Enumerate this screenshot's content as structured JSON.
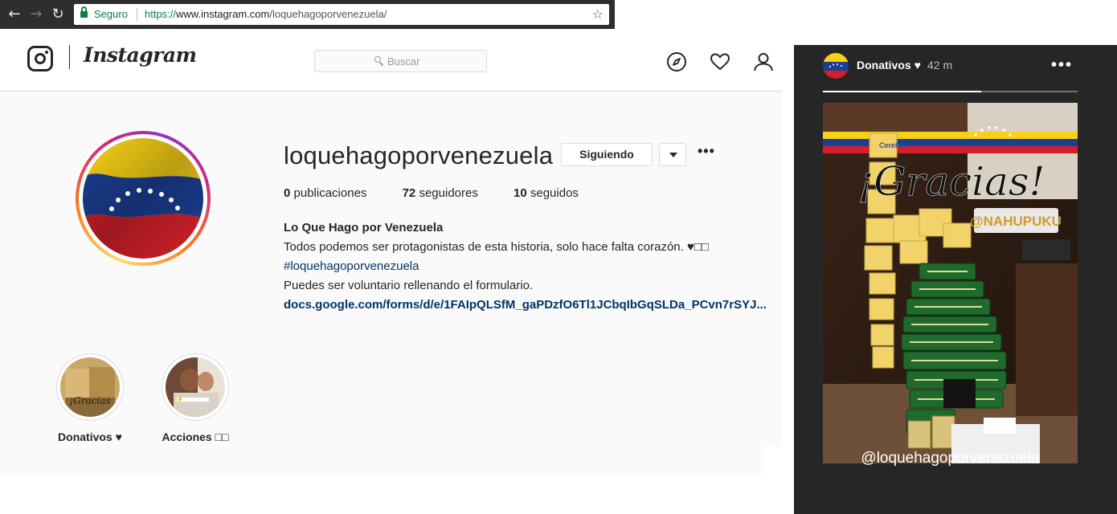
{
  "browser": {
    "secure_label": "Seguro",
    "url_scheme": "https://",
    "url_host": "www.instagram.com",
    "url_path": "/loquehagoporvenezuela/"
  },
  "header": {
    "wordmark": "Instagram",
    "search_placeholder": "Buscar"
  },
  "profile": {
    "username": "loquehagoporvenezuela",
    "follow_button": "Siguiendo",
    "more_label": "•••",
    "stats": {
      "posts": "0",
      "posts_label": "publicaciones",
      "followers": "72",
      "followers_label": "seguidores",
      "following": "10",
      "following_label": "seguidos"
    },
    "bio": {
      "name": "Lo Que Hago por Venezuela",
      "line1": "Todos podemos ser protagonistas de esta historia, solo hace falta corazón. ♥□□",
      "hashtag": "#loquehagoporvenezuela",
      "line3": "Puedes ser voluntario rellenando el formulario.",
      "link": "docs.google.com/forms/d/e/1FAIpQLSfM_gaPDzfO6Tl1JCbqIbGqSLDa_PCvn7rSYJ..."
    },
    "highlights": [
      {
        "label": "Donativos ♥"
      },
      {
        "label": "Acciones □□"
      }
    ]
  },
  "story": {
    "title": "Donativos ♥",
    "time": "42 m",
    "more_label": "•••",
    "progress_fraction": 0.62,
    "thanks_text": "¡Gracias!",
    "tag": "@NAHUPUKU",
    "handle": "@loquehagoporvenezuela",
    "product_label": "Cerelac"
  },
  "colors": {
    "flag_yellow": "#f7d117",
    "flag_blue": "#1c3f94",
    "flag_red": "#d3202a",
    "link": "#003569"
  }
}
